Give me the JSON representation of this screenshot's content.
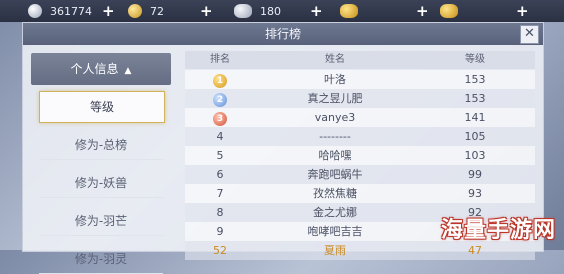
{
  "currencies": [
    {
      "icon": "silver-coin-icon",
      "value": "361774"
    },
    {
      "icon": "gold-coin-icon",
      "value": "72"
    },
    {
      "icon": "silver-ingot-icon",
      "value": "180"
    },
    {
      "icon": "gold-ingot-icon",
      "value": ""
    },
    {
      "icon": "gold-ingot-icon",
      "value": ""
    }
  ],
  "plus_label": "+",
  "panel": {
    "title": "排行榜",
    "close_label": "✕"
  },
  "side": {
    "header": "个人信息",
    "header_icon": "triangle-up-icon",
    "items": [
      "等级",
      "修为-总榜",
      "修为-妖兽",
      "修为-羽芒",
      "修为-羽灵"
    ],
    "active_index": 0
  },
  "table": {
    "headers": [
      "排名",
      "姓名",
      "等级"
    ],
    "rows": [
      {
        "rank": "1",
        "name": "叶洛",
        "level": "153",
        "medal": "gold"
      },
      {
        "rank": "2",
        "name": "真之昱儿肥",
        "level": "153",
        "medal": "silver"
      },
      {
        "rank": "3",
        "name": "vanye3",
        "level": "141",
        "medal": "bronze"
      },
      {
        "rank": "4",
        "name": "--------",
        "level": "105"
      },
      {
        "rank": "5",
        "name": "哈哈嘿",
        "level": "103"
      },
      {
        "rank": "6",
        "name": "奔跑吧蜗牛",
        "level": "99"
      },
      {
        "rank": "7",
        "name": "孜然焦糖",
        "level": "93"
      },
      {
        "rank": "8",
        "name": "金之尤娜",
        "level": "92"
      },
      {
        "rank": "9",
        "name": "咆哮吧吉吉",
        "level": "90"
      },
      {
        "rank": "52",
        "name": "夏雨",
        "level": "47",
        "mine": true
      }
    ]
  },
  "watermark": "海量手游网",
  "colors": {
    "accent_gold": "#d0b15d",
    "title_bar": "#59617a",
    "own_row": "#c98a22"
  }
}
